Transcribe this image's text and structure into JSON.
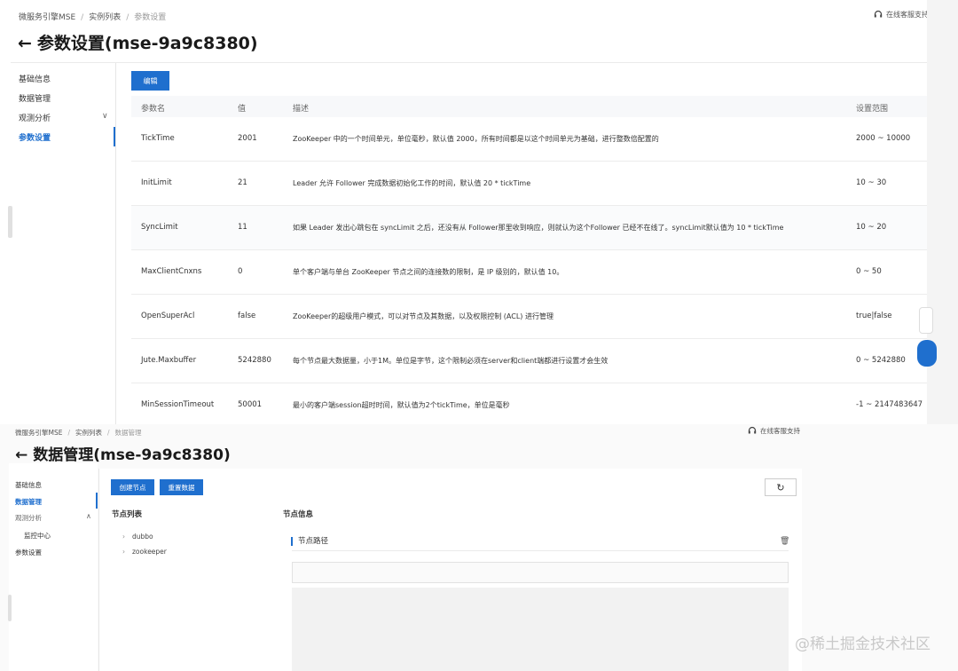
{
  "panel1": {
    "breadcrumb": [
      "微服务引擎MSE",
      "实例列表",
      "参数设置"
    ],
    "support": "在线客服支持",
    "back_arrow": "←",
    "title": "参数设置(mse-9a9c8380)",
    "sidebar": [
      {
        "label": "基础信息"
      },
      {
        "label": "数据管理"
      },
      {
        "label": "观测分析",
        "chevron": "∨"
      },
      {
        "label": "参数设置"
      }
    ],
    "edit_button": "编辑",
    "columns": [
      "参数名",
      "值",
      "描述",
      "设置范围"
    ],
    "rows": [
      {
        "name": "TickTime",
        "value": "2001",
        "desc": "ZooKeeper 中的一个时间单元，单位毫秒，默认值 2000，所有时间都是以这个时间单元为基础，进行整数倍配置的",
        "range": "2000 ~ 10000"
      },
      {
        "name": "InitLimit",
        "value": "21",
        "desc": "Leader 允许 Follower 完成数据初始化工作的时间，默认值 20 * tickTime",
        "range": "10 ~ 30"
      },
      {
        "name": "SyncLimit",
        "value": "11",
        "desc": "如果 Leader 发出心跳包在 syncLimit 之后，还没有从 Follower那里收到响应，则就认为这个Follower 已经不在线了。syncLimit默认值为 10 * tickTime",
        "range": "10 ~ 20"
      },
      {
        "name": "MaxClientCnxns",
        "value": "0",
        "desc": "单个客户端与单台 ZooKeeper 节点之间的连接数的限制，是 IP 级别的，默认值 10。",
        "range": "0 ~ 50"
      },
      {
        "name": "OpenSuperAcl",
        "value": "false",
        "desc": "ZooKeeper的超级用户模式，可以对节点及其数据，以及权限控制 (ACL) 进行管理",
        "range": "true|false"
      },
      {
        "name": "Jute.Maxbuffer",
        "value": "5242880",
        "desc": "每个节点最大数据量，小于1M。单位是字节，这个限制必须在server和client端都进行设置才会生效",
        "range": "0 ~ 5242880"
      },
      {
        "name": "MinSessionTimeout",
        "value": "50001",
        "desc": "最小的客户端session超时时间，默认值为2个tickTime，单位是毫秒",
        "range": "-1 ~ 2147483647"
      }
    ]
  },
  "panel2": {
    "breadcrumb": [
      "微服务引擎MSE",
      "实例列表",
      "数据管理"
    ],
    "support": "在线客服支持",
    "back_arrow": "←",
    "title": "数据管理(mse-9a9c8380)",
    "sidebar": [
      {
        "label": "基础信息"
      },
      {
        "label": "数据管理"
      },
      {
        "label": "观测分析",
        "chevron": "∧"
      },
      {
        "label": "监控中心"
      },
      {
        "label": "参数设置"
      }
    ],
    "create_node_button": "创建节点",
    "reset_data_button": "重置数据",
    "refresh_icon": "↻",
    "node_list_title": "节点列表",
    "node_info_title": "节点信息",
    "tree": [
      {
        "caret": "›",
        "label": "dubbo"
      },
      {
        "caret": "›",
        "label": "zookeeper"
      }
    ],
    "node_path_label": "节点路径",
    "trash_icon": "🗑"
  },
  "watermark": "@稀土掘金技术社区"
}
